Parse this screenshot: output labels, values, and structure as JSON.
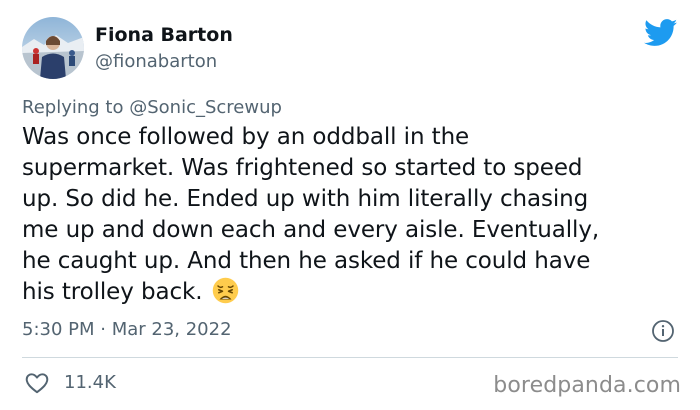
{
  "author": {
    "display_name": "Fiona Barton",
    "handle": "@fionabarton",
    "avatar_icon": "avatar-photo"
  },
  "platform_icon": "twitter-bird-icon",
  "colors": {
    "twitter_blue": "#1d9bf0",
    "text_primary": "#0f1419",
    "text_secondary": "#536471",
    "divider": "#cfd9de"
  },
  "reply": {
    "prefix": "Replying to",
    "mention": "@Sonic_Screwup"
  },
  "tweet": {
    "text": "Was once followed by an oddball in the\nsupermarket. Was frightened so started to speed\nup. So did he. Ended up with him literally chasing\nme up and down each and every aisle.  Eventually,\nhe caught up. And then he asked if he could have\nhis trolley back.",
    "emoji": "weary-face-emoji",
    "timestamp": "5:30 PM · Mar 23, 2022"
  },
  "engagement": {
    "likes": "11.4K"
  },
  "watermark": "boredpanda.com"
}
